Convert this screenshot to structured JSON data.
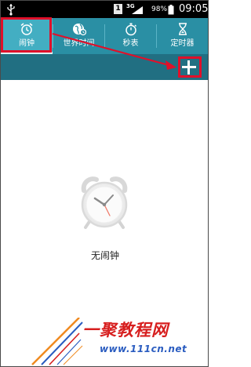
{
  "status_bar": {
    "sim_label": "1",
    "network_label": "3G",
    "battery_percent": "98%",
    "time": "09:05",
    "icons": [
      "usb-icon",
      "sim-icon",
      "signal-icon",
      "battery-icon"
    ]
  },
  "tabs": [
    {
      "label": "闹钟",
      "icon": "alarm-clock-icon",
      "active": true
    },
    {
      "label": "世界时间",
      "icon": "globe-icon",
      "active": false
    },
    {
      "label": "秒表",
      "icon": "stopwatch-icon",
      "active": false
    },
    {
      "label": "定时器",
      "icon": "hourglass-icon",
      "active": false
    }
  ],
  "action_bar": {
    "add_icon": "plus-icon"
  },
  "empty_state": {
    "icon": "alarm-clock-icon",
    "text": "无闹钟"
  },
  "watermark": {
    "title": "一聚教程网",
    "url": "www.111cn.net"
  },
  "colors": {
    "tab_bar": "#2a8fa4",
    "tab_active": "#43aec2",
    "action_bar": "#216f82",
    "highlight": "#e0102a",
    "watermark_red": "#d71f1f",
    "watermark_blue": "#2a5cc0"
  }
}
